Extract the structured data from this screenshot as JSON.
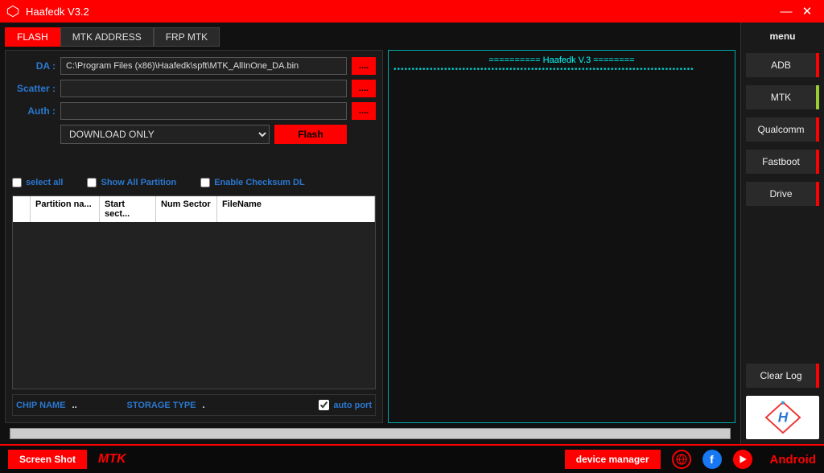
{
  "title": "Haafedk V3.2",
  "tabs": {
    "flash": "FLASH",
    "mtk_addr": "MTK  ADDRESS",
    "frp_mtk": "FRP MTK"
  },
  "form": {
    "da_label": "DA :",
    "da_value": "C:\\Program Files (x86)\\Haafedk\\spft\\MTK_AllInOne_DA.bin",
    "scatter_label": "Scatter :",
    "scatter_value": "",
    "auth_label": "Auth :",
    "auth_value": "",
    "browse": "....",
    "mode": "DOWNLOAD ONLY",
    "flash_btn": "Flash"
  },
  "checks": {
    "select_all": "select all",
    "show_all": "Show All Partition",
    "checksum": "Enable Checksum DL"
  },
  "table": {
    "h0": "",
    "h1": "Partition na...",
    "h2": "Start sect...",
    "h3": "Num Sector",
    "h4": "FileName"
  },
  "chip": {
    "chip_label": "CHIP NAME",
    "chip_value": "..",
    "storage_label": "STORAGE TYPE",
    "storage_value": ".",
    "autoport": "auto port"
  },
  "log": {
    "header": "========== Haafedk V.3 ========",
    "dots": "•••••••••••••••••••••••••••••••••••••••••••••••••••••••••••••••••••••••••••••••••••"
  },
  "sidebar": {
    "menu": "menu",
    "adb": "ADB",
    "mtk": "MTK",
    "qualcomm": "Qualcomm",
    "fastboot": "Fastboot",
    "drive": "Drive",
    "clear": "Clear Log"
  },
  "footer": {
    "screenshot": "Screen Shot",
    "mode": "MTK",
    "devmgr": "device manager",
    "android": "Android"
  }
}
